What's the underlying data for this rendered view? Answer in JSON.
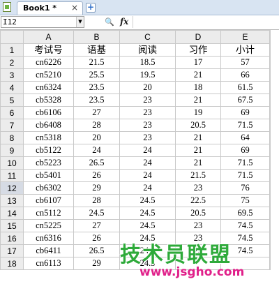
{
  "tabbar": {
    "tab_label": "Book1 *",
    "close_glyph": "×",
    "new_tab_glyph": "+"
  },
  "formula_bar": {
    "name_box_value": "I12",
    "dropdown_glyph": "▼",
    "zoom_glyph": "🔍",
    "fx_label": "fx",
    "formula_value": ""
  },
  "grid": {
    "column_headers": [
      "A",
      "B",
      "C",
      "D",
      "E"
    ],
    "active_row": 12,
    "rows": [
      [
        "考试号",
        "语基",
        "阅读",
        "习作",
        "小计"
      ],
      [
        "cn6226",
        "21.5",
        "18.5",
        "17",
        "57"
      ],
      [
        "cn5210",
        "25.5",
        "19.5",
        "21",
        "66"
      ],
      [
        "cn6324",
        "23.5",
        "20",
        "18",
        "61.5"
      ],
      [
        "cb5328",
        "23.5",
        "23",
        "21",
        "67.5"
      ],
      [
        "cb6106",
        "27",
        "23",
        "19",
        "69"
      ],
      [
        "cb6408",
        "28",
        "23",
        "20.5",
        "71.5"
      ],
      [
        "cn5318",
        "20",
        "23",
        "21",
        "64"
      ],
      [
        "cb5122",
        "24",
        "24",
        "21",
        "69"
      ],
      [
        "cb5223",
        "26.5",
        "24",
        "21",
        "71.5"
      ],
      [
        "cb5401",
        "26",
        "24",
        "21.5",
        "71.5"
      ],
      [
        "cb6302",
        "29",
        "24",
        "23",
        "76"
      ],
      [
        "cb6107",
        "28",
        "24.5",
        "22.5",
        "75"
      ],
      [
        "cn5112",
        "24.5",
        "24.5",
        "20.5",
        "69.5"
      ],
      [
        "cn5225",
        "27",
        "24.5",
        "23",
        "74.5"
      ],
      [
        "cn6316",
        "26",
        "24.5",
        "23",
        "74.5"
      ],
      [
        "cb6411",
        "26.5",
        "24.5",
        "23",
        "74.5"
      ],
      [
        "cn6113",
        "29",
        "24.5",
        "",
        ""
      ]
    ]
  },
  "watermark": {
    "text": "技术员联盟",
    "url": "www.jsgho.com"
  },
  "colors": {
    "tabbar_bg": "#d8e4f2",
    "header_bg": "#ececec",
    "active_row_header_bg": "#d6dbe4",
    "watermark_green": "#2eaa3a",
    "watermark_pink": "#e0208a"
  }
}
